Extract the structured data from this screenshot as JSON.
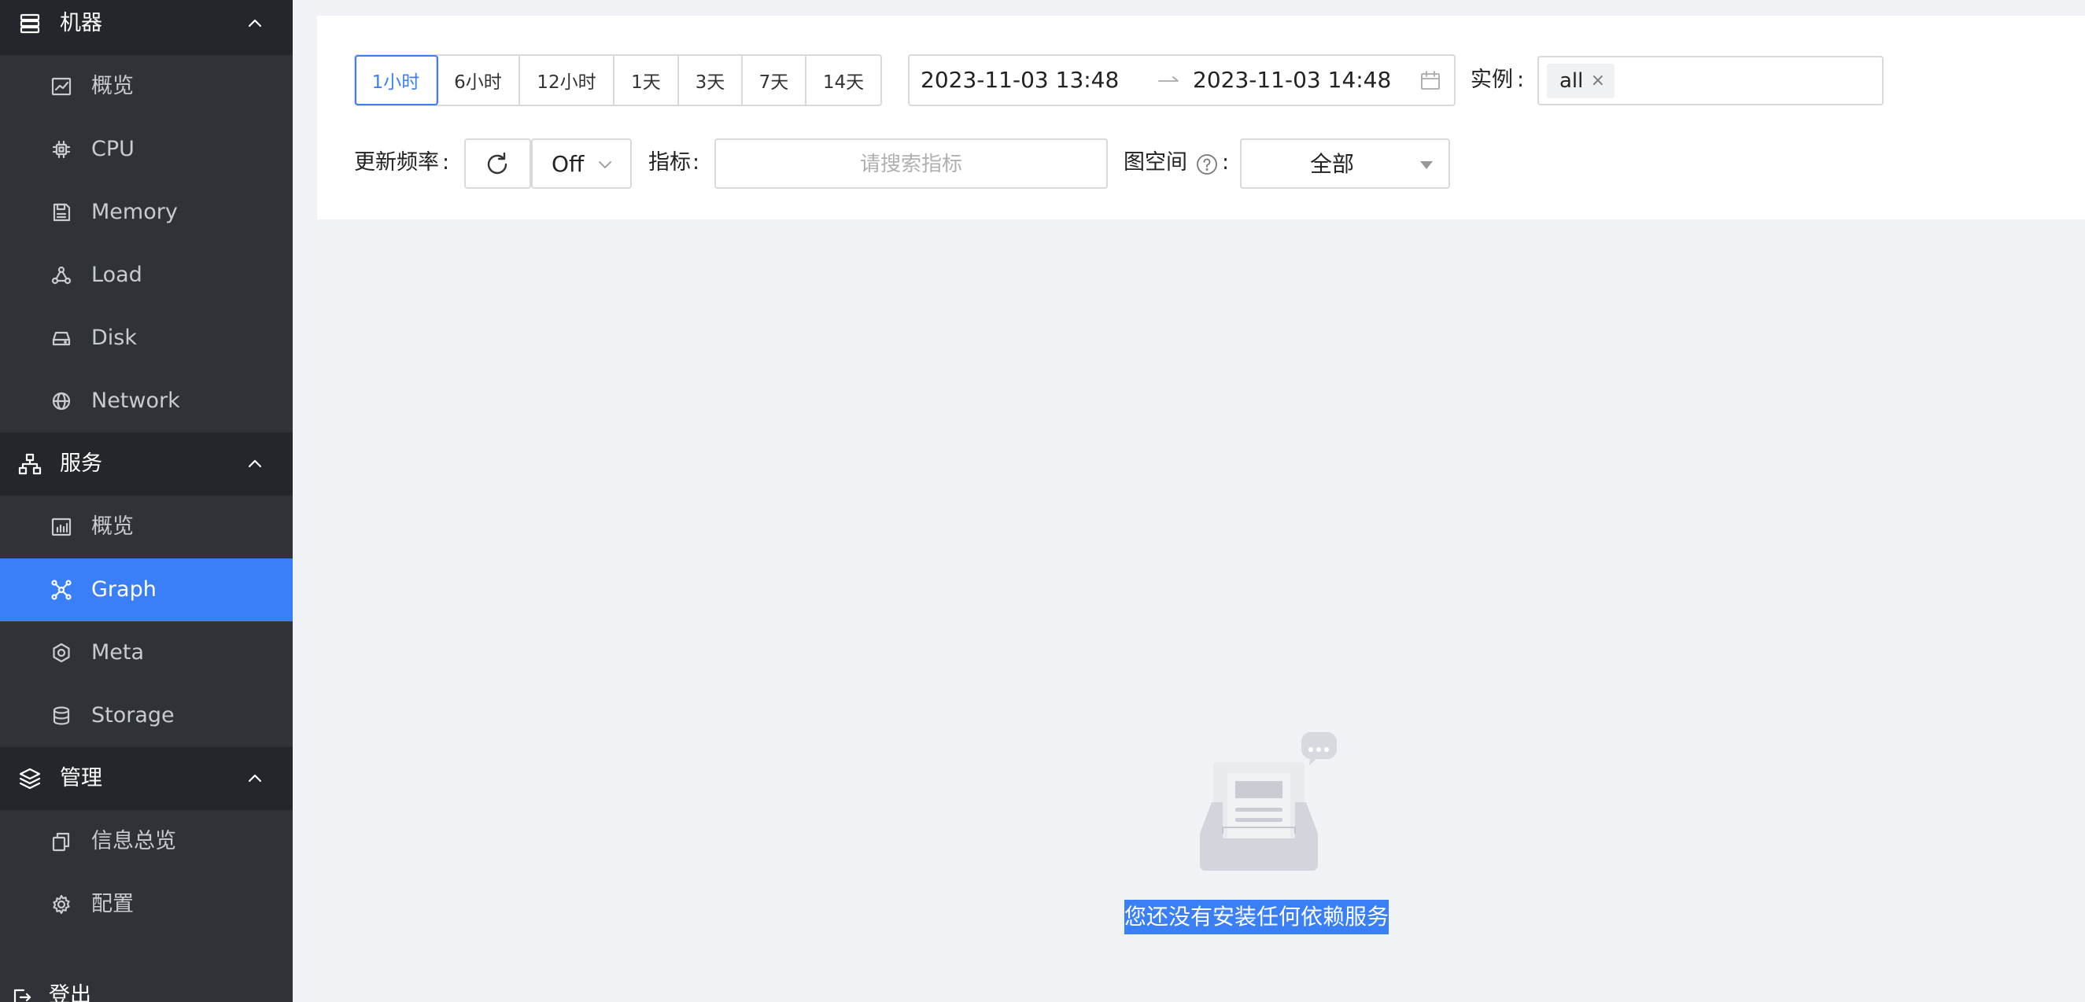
{
  "sidebar": {
    "groups": [
      {
        "label": "机器",
        "icon": "server-icon",
        "items": [
          {
            "label": "概览",
            "icon": "line-chart-icon"
          },
          {
            "label": "CPU",
            "icon": "cpu-icon"
          },
          {
            "label": "Memory",
            "icon": "memory-icon"
          },
          {
            "label": "Load",
            "icon": "load-icon"
          },
          {
            "label": "Disk",
            "icon": "disk-icon"
          },
          {
            "label": "Network",
            "icon": "globe-icon"
          }
        ]
      },
      {
        "label": "服务",
        "icon": "sitemap-icon",
        "items": [
          {
            "label": "概览",
            "icon": "bar-chart-icon"
          },
          {
            "label": "Graph",
            "icon": "graph-icon",
            "active": true
          },
          {
            "label": "Meta",
            "icon": "hexagon-icon"
          },
          {
            "label": "Storage",
            "icon": "database-icon"
          }
        ]
      },
      {
        "label": "管理",
        "icon": "layers-icon",
        "items": [
          {
            "label": "信息总览",
            "icon": "copy-icon"
          },
          {
            "label": "配置",
            "icon": "gear-icon"
          }
        ]
      }
    ],
    "logout_label": "登出"
  },
  "toolbar": {
    "time_ranges": [
      "1小时",
      "6小时",
      "12小时",
      "1天",
      "3天",
      "7天",
      "14天"
    ],
    "selected_range": "1小时",
    "start_time": "2023-11-03 13:48",
    "end_time": "2023-11-03 14:48",
    "instance_label": "实例",
    "instance_tag": "all",
    "refresh_label": "更新频率",
    "refresh_value": "Off",
    "metric_label": "指标",
    "metric_placeholder": "请搜索指标",
    "space_label": "图空间",
    "space_value": "全部"
  },
  "empty_state": {
    "message": "您还没有安装任何依赖服务"
  },
  "colors": {
    "sidebar_bg": "#2f3337",
    "group_bg": "#23272b",
    "accent": "#3a7ff5"
  }
}
